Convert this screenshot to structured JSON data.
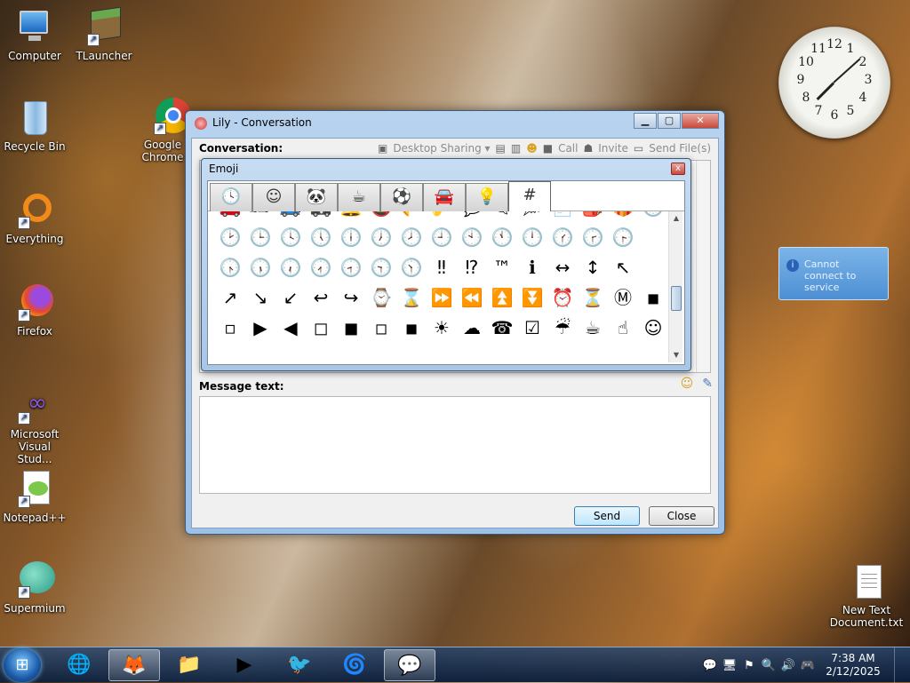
{
  "desktop": {
    "icons": [
      {
        "label": "Computer"
      },
      {
        "label": "TLauncher"
      },
      {
        "label": "Recycle Bin"
      },
      {
        "label": "Google Chrome"
      },
      {
        "label": "Everything"
      },
      {
        "label": "Firefox"
      },
      {
        "label": "Microsoft Visual Stud..."
      },
      {
        "label": "Notepad++"
      },
      {
        "label": "Supermium"
      },
      {
        "label": "New Text Document.txt"
      }
    ],
    "balloon": {
      "text": "Cannot connect to service",
      "icon": "info-icon"
    },
    "clock": {
      "hour_numerals": [
        "12",
        "1",
        "2",
        "3",
        "4",
        "5",
        "6",
        "7",
        "8",
        "9",
        "10",
        "11"
      ]
    }
  },
  "conversation_window": {
    "title": "Lily - Conversation",
    "minimize": "▁",
    "maximize": "▢",
    "close": "✕",
    "conversation_label": "Conversation:",
    "toolbar": {
      "desktop_sharing": "Desktop Sharing ▾",
      "call": "Call",
      "invite": "Invite",
      "send_files": "Send File(s)"
    },
    "message_label": "Message text:",
    "send": "Send",
    "close_button": "Close"
  },
  "emoji_dialog": {
    "title": "Emoji",
    "close": "x",
    "tabs": [
      "🕓",
      "☺",
      "🐼",
      "☕",
      "⚽",
      "🚘",
      "💡",
      "#"
    ],
    "active_tab": 7,
    "rows": [
      [
        "🚗",
        "🏎",
        "🚙",
        "🚓",
        "🔔",
        "🔕",
        "🎺",
        "🎷",
        "💬",
        "🗨",
        "🗯",
        "📄",
        "🎒",
        "🎁",
        "🕐"
      ],
      [
        "🕑",
        "🕒",
        "🕓",
        "🕔",
        "🕕",
        "🕖",
        "🕗",
        "🕘",
        "🕙",
        "🕚",
        "🕛",
        "🕜",
        "🕝",
        "🕞"
      ],
      [
        "🕟",
        "🕠",
        "🕡",
        "🕢",
        "🕣",
        "🕤",
        "🕥",
        "‼",
        "⁉",
        "™",
        "ℹ",
        "↔",
        "↕",
        "↖"
      ],
      [
        "↗",
        "↘",
        "↙",
        "↩",
        "↪",
        "⌚",
        "⌛",
        "⏩",
        "⏪",
        "⏫",
        "⏬",
        "⏰",
        "⏳",
        "Ⓜ",
        "◾"
      ],
      [
        "▫",
        "▶",
        "◀",
        "◻",
        "◼",
        "◽",
        "◾",
        "☀",
        "☁",
        "☎",
        "☑",
        "☔",
        "☕",
        "☝",
        "☺"
      ]
    ]
  },
  "taskbar": {
    "start_icon": "windows-orb-icon",
    "buttons": [
      "🌐",
      "🦊",
      "📁",
      "▶",
      "🐦",
      "🌀",
      "💬"
    ],
    "tray_icons": [
      "💬",
      "🖥",
      "⚑",
      "🔍",
      "🔊",
      "🎮"
    ],
    "time": "7:38 AM",
    "date": "2/12/2025"
  }
}
